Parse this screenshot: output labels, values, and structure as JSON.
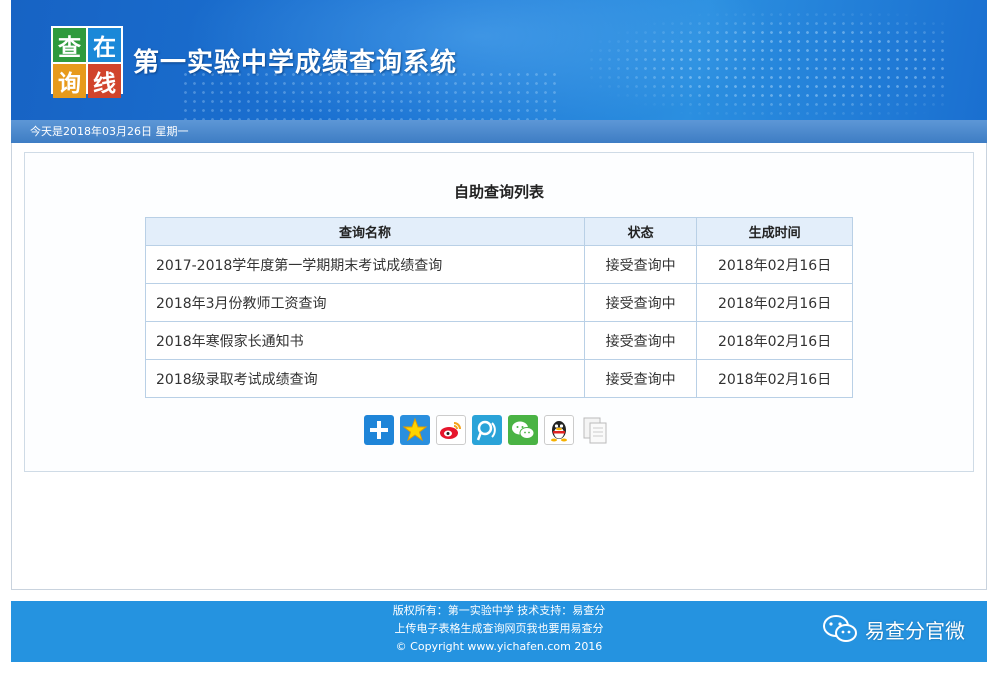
{
  "header": {
    "logo_chars": [
      "查",
      "在",
      "询",
      "线"
    ],
    "title": "第一实验中学成绩查询系统"
  },
  "datebar": {
    "text": "今天是2018年03月26日 星期一"
  },
  "list": {
    "title": "自助查询列表",
    "columns": [
      "查询名称",
      "状态",
      "生成时间"
    ],
    "rows": [
      {
        "name": "2017-2018学年度第一学期期末考试成绩查询",
        "status": "接受查询中",
        "time": "2018年02月16日"
      },
      {
        "name": "2018年3月份教师工资查询",
        "status": "接受查询中",
        "time": "2018年02月16日"
      },
      {
        "name": "2018年寒假家长通知书",
        "status": "接受查询中",
        "time": "2018年02月16日"
      },
      {
        "name": "2018级录取考试成绩查询",
        "status": "接受查询中",
        "time": "2018年02月16日"
      }
    ]
  },
  "share": {
    "icons": [
      "plus-more-icon",
      "qzone-star-icon",
      "weibo-icon",
      "tencent-weibo-icon",
      "wechat-icon",
      "qq-penguin-icon",
      "copy-icon"
    ]
  },
  "footer": {
    "line1": "版权所有：第一实验中学  技术支持：易查分",
    "line2": "上传电子表格生成查询网页我也要用易查分",
    "line3": "© Copyright www.yichafen.com 2016"
  },
  "watermark": {
    "text": "易查分官微"
  },
  "colors": {
    "header_blue": "#1b73d3",
    "datebar_blue": "#4a88cc",
    "footer_blue": "#2593e0",
    "table_header_bg": "#e3eefa"
  }
}
